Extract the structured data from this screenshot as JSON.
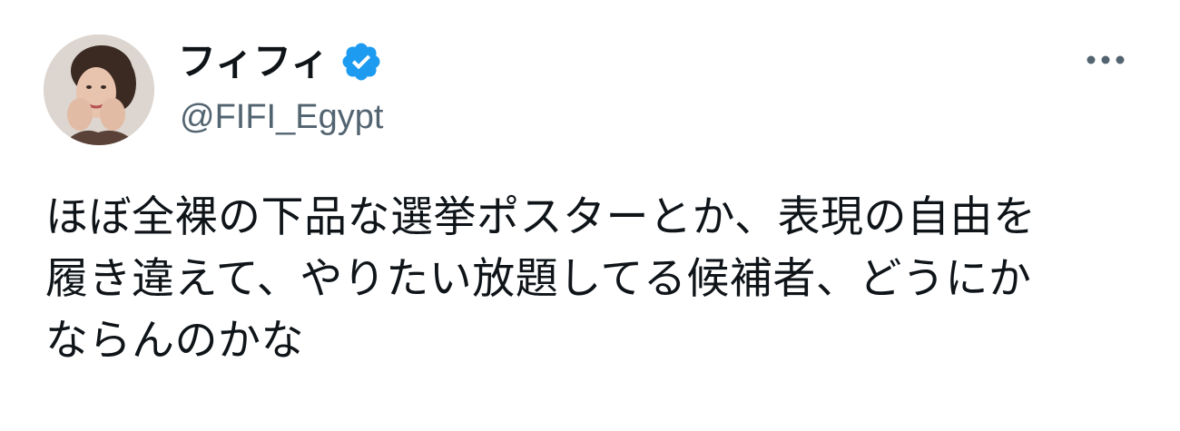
{
  "tweet": {
    "author": {
      "display_name": "フィフィ",
      "handle": "@FIFI_Egypt",
      "verified": true,
      "avatar_icon": "profile-photo",
      "verified_icon": "verified-badge-icon",
      "verified_color": "#1d9bf0"
    },
    "more_icon": "more-options-icon",
    "text_lines": [
      "ほぼ全裸の下品な選挙ポスターとか、表現の自由を",
      "履き違えて、やりたい放題してる候補者、どうにか",
      "ならんのかな"
    ]
  },
  "colors": {
    "text_primary": "#0f1419",
    "text_secondary": "#536471",
    "background": "#ffffff"
  }
}
